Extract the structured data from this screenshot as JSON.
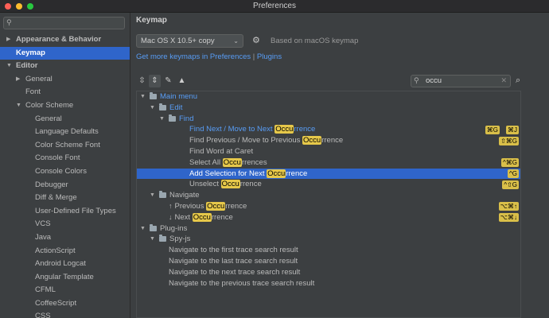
{
  "window": {
    "title": "Preferences"
  },
  "sidebar": {
    "search_placeholder": "",
    "items": [
      {
        "label": "Appearance & Behavior",
        "level": 0,
        "arrow": "▶",
        "bold": true,
        "selected": false
      },
      {
        "label": "Keymap",
        "level": 0,
        "arrow": "",
        "bold": true,
        "selected": true
      },
      {
        "label": "Editor",
        "level": 0,
        "arrow": "▼",
        "bold": true,
        "selected": false
      },
      {
        "label": "General",
        "level": 1,
        "arrow": "▶",
        "bold": false,
        "selected": false
      },
      {
        "label": "Font",
        "level": 1,
        "arrow": "",
        "bold": false,
        "selected": false
      },
      {
        "label": "Color Scheme",
        "level": 1,
        "arrow": "▼",
        "bold": false,
        "selected": false
      },
      {
        "label": "General",
        "level": 2,
        "arrow": "",
        "bold": false,
        "selected": false
      },
      {
        "label": "Language Defaults",
        "level": 2,
        "arrow": "",
        "bold": false,
        "selected": false
      },
      {
        "label": "Color Scheme Font",
        "level": 2,
        "arrow": "",
        "bold": false,
        "selected": false
      },
      {
        "label": "Console Font",
        "level": 2,
        "arrow": "",
        "bold": false,
        "selected": false
      },
      {
        "label": "Console Colors",
        "level": 2,
        "arrow": "",
        "bold": false,
        "selected": false
      },
      {
        "label": "Debugger",
        "level": 2,
        "arrow": "",
        "bold": false,
        "selected": false
      },
      {
        "label": "Diff & Merge",
        "level": 2,
        "arrow": "",
        "bold": false,
        "selected": false
      },
      {
        "label": "User-Defined File Types",
        "level": 2,
        "arrow": "",
        "bold": false,
        "selected": false
      },
      {
        "label": "VCS",
        "level": 2,
        "arrow": "",
        "bold": false,
        "selected": false
      },
      {
        "label": "Java",
        "level": 2,
        "arrow": "",
        "bold": false,
        "selected": false
      },
      {
        "label": "ActionScript",
        "level": 2,
        "arrow": "",
        "bold": false,
        "selected": false
      },
      {
        "label": "Android Logcat",
        "level": 2,
        "arrow": "",
        "bold": false,
        "selected": false
      },
      {
        "label": "Angular Template",
        "level": 2,
        "arrow": "",
        "bold": false,
        "selected": false
      },
      {
        "label": "CFML",
        "level": 2,
        "arrow": "",
        "bold": false,
        "selected": false
      },
      {
        "label": "CoffeeScript",
        "level": 2,
        "arrow": "",
        "bold": false,
        "selected": false
      },
      {
        "label": "CSS",
        "level": 2,
        "arrow": "",
        "bold": false,
        "selected": false
      }
    ]
  },
  "main": {
    "header": "Keymap",
    "keymap_selected": "Mac OS X 10.5+ copy",
    "based_on": "Based on macOS keymap",
    "link_more": "Get more keymaps in Preferences",
    "link_sep": "|",
    "link_plugins": "Plugins",
    "filter_value": "occu",
    "toolbar_icons": [
      "expand-all-icon",
      "collapse-all-icon",
      "edit-icon",
      "warning-icon"
    ],
    "tree": [
      {
        "id": "main-menu",
        "level": 0,
        "arrow": "▼",
        "folder": true,
        "parts": [
          "Main menu"
        ],
        "blue": true,
        "selected": false,
        "keys": []
      },
      {
        "id": "edit",
        "level": 1,
        "arrow": "▼",
        "folder": true,
        "parts": [
          "Edit"
        ],
        "blue": true,
        "selected": false,
        "keys": []
      },
      {
        "id": "find",
        "level": 2,
        "arrow": "▼",
        "folder": true,
        "parts": [
          "Find"
        ],
        "blue": true,
        "selected": false,
        "keys": []
      },
      {
        "id": "find-next",
        "level": 3,
        "arrow": "",
        "folder": false,
        "parts": [
          "Find Next / Move to Next ",
          "Occu",
          "rrence"
        ],
        "blue": true,
        "selected": false,
        "keys": [
          "⌘G",
          "⌘J"
        ]
      },
      {
        "id": "find-prev",
        "level": 3,
        "arrow": "",
        "folder": false,
        "parts": [
          "Find Previous / Move to Previous ",
          "Occu",
          "rrence"
        ],
        "blue": false,
        "selected": false,
        "keys": [
          "⇧⌘G"
        ]
      },
      {
        "id": "find-word",
        "level": 3,
        "arrow": "",
        "folder": false,
        "parts": [
          "Find Word at Caret"
        ],
        "blue": false,
        "selected": false,
        "keys": []
      },
      {
        "id": "select-all",
        "level": 3,
        "arrow": "",
        "folder": false,
        "parts": [
          "Select All ",
          "Occu",
          "rrences"
        ],
        "blue": false,
        "selected": false,
        "keys": [
          "^⌘G"
        ]
      },
      {
        "id": "add-selection",
        "level": 3,
        "arrow": "",
        "folder": false,
        "parts": [
          "Add Selection for Next ",
          "Occu",
          "rrence"
        ],
        "blue": false,
        "selected": true,
        "keys": [
          "^G"
        ]
      },
      {
        "id": "unselect",
        "level": 3,
        "arrow": "",
        "folder": false,
        "parts": [
          "Unselect ",
          "Occu",
          "rrence"
        ],
        "blue": false,
        "selected": false,
        "keys": [
          "^⇧G"
        ]
      },
      {
        "id": "navigate",
        "level": 1,
        "arrow": "▼",
        "folder": true,
        "parts": [
          "Navigate"
        ],
        "blue": false,
        "selected": false,
        "keys": []
      },
      {
        "id": "prev-occ",
        "level": 2,
        "arrow": "",
        "folder": false,
        "icon": "↑",
        "parts": [
          "Previous ",
          "Occu",
          "rrence"
        ],
        "blue": false,
        "selected": false,
        "keys": [
          "⌥⌘↑"
        ]
      },
      {
        "id": "next-occ",
        "level": 2,
        "arrow": "",
        "folder": false,
        "icon": "↓",
        "parts": [
          "Next ",
          "Occu",
          "rrence"
        ],
        "blue": false,
        "selected": false,
        "keys": [
          "⌥⌘↓"
        ]
      },
      {
        "id": "plugins",
        "level": 0,
        "arrow": "▼",
        "folder": true,
        "parts": [
          "Plug-ins"
        ],
        "blue": false,
        "selected": false,
        "keys": []
      },
      {
        "id": "spy-js",
        "level": 1,
        "arrow": "▼",
        "folder": true,
        "parts": [
          "Spy-js"
        ],
        "blue": false,
        "selected": false,
        "keys": []
      },
      {
        "id": "nav-first",
        "level": 2,
        "arrow": "",
        "folder": false,
        "parts": [
          "Navigate to the first trace search result"
        ],
        "blue": false,
        "selected": false,
        "keys": []
      },
      {
        "id": "nav-last",
        "level": 2,
        "arrow": "",
        "folder": false,
        "parts": [
          "Navigate to the last trace search result"
        ],
        "blue": false,
        "selected": false,
        "keys": []
      },
      {
        "id": "nav-next",
        "level": 2,
        "arrow": "",
        "folder": false,
        "parts": [
          "Navigate to the next trace search result"
        ],
        "blue": false,
        "selected": false,
        "keys": []
      },
      {
        "id": "nav-prev",
        "level": 2,
        "arrow": "",
        "folder": false,
        "parts": [
          "Navigate to the previous trace search result"
        ],
        "blue": false,
        "selected": false,
        "keys": []
      }
    ]
  },
  "colors": {
    "accent": "#2f65ca",
    "highlight": "#e6c84a",
    "link": "#589df6"
  }
}
